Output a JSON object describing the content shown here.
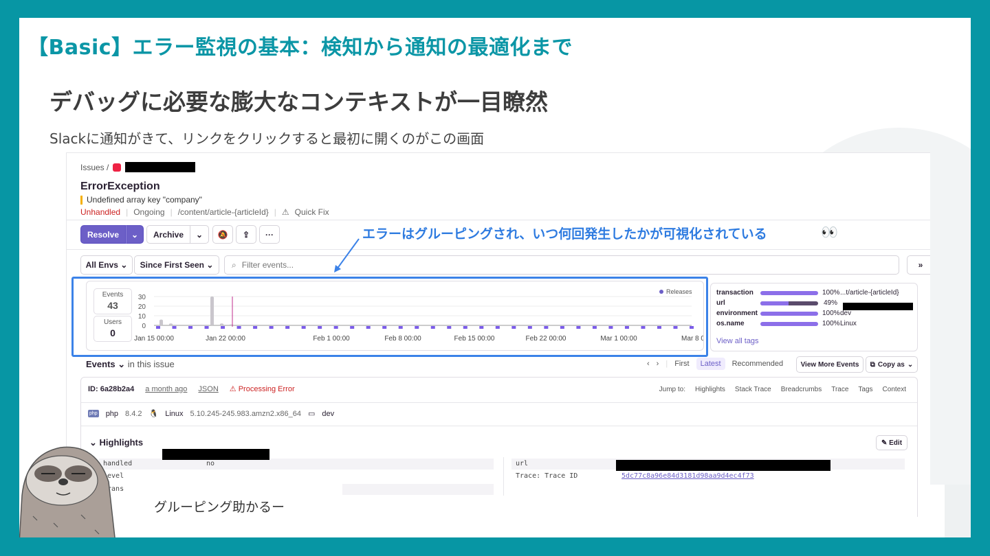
{
  "slide": {
    "title": "【Basic】エラー監視の基本：検知から通知の最適化まで",
    "heading": "デバッグに必要な膨大なコンテキストが一目瞭然",
    "subtitle": "Slackに通知がきて、リンクをクリックすると最初に開くのがこの画面",
    "annotation": "エラーはグルーピングされ、いつ何回発生したかが可視化されている",
    "eyes": "👀",
    "caption": "グルーピング助かるー",
    "colors": {
      "slide_bg": "#0796a4",
      "title": "#0b96a6",
      "annotation": "#2e7be0",
      "accent": "#6c5fc7"
    }
  },
  "issue": {
    "breadcrumb": "Issues /",
    "title": "ErrorException",
    "message": "Undefined array key \"company\"",
    "status": "Unhandled",
    "state": "Ongoing",
    "culprit": "/content/article-{articleId}",
    "quick_fix": "Quick Fix"
  },
  "toolbar": {
    "resolve": "Resolve",
    "archive": "Archive",
    "more": "···"
  },
  "filters": {
    "env": "All Envs",
    "period": "Since First Seen",
    "search_placeholder": "Filter events...",
    "expand": "»"
  },
  "stats": {
    "events_label": "Events",
    "events_value": "43",
    "users_label": "Users",
    "users_value": "0"
  },
  "chart_data": {
    "type": "bar",
    "y_ticks": [
      "30",
      "20",
      "10",
      "0"
    ],
    "ylim": [
      0,
      30
    ],
    "x_tick_labels": [
      "Jan 15 00:00",
      "Jan 22 00:00",
      "Feb 1 00:00",
      "Feb 8 00:00",
      "Feb 15 00:00",
      "Feb 22 00:00",
      "Mar 1 00:00",
      "Mar 8 0"
    ],
    "legend": "Releases",
    "series": [
      {
        "values": [
          6,
          2,
          0,
          0,
          30,
          2,
          1,
          0,
          0
        ]
      }
    ],
    "release_markers": 34
  },
  "tags": {
    "rows": [
      {
        "key": "transaction",
        "pct": "100%",
        "value": "...t/article-{articleId}",
        "fill": 1.0
      },
      {
        "key": "url",
        "pct": "49%",
        "value": "",
        "fill": 0.49
      },
      {
        "key": "environment",
        "pct": "100%",
        "value": "dev",
        "fill": 1.0
      },
      {
        "key": "os.name",
        "pct": "100%",
        "value": "Linux",
        "fill": 1.0
      }
    ],
    "view_all": "View all tags"
  },
  "events": {
    "label": "Events",
    "scope": "in this issue",
    "first": "First",
    "latest": "Latest",
    "recommended": "Recommended",
    "view_more": "View More Events",
    "copy_as": "Copy as"
  },
  "event": {
    "id": "ID: 6a28b2a4",
    "time": "a month ago",
    "json": "JSON",
    "processing_error": "Processing Error",
    "jump_label": "Jump to:",
    "jump": [
      "Highlights",
      "Stack Trace",
      "Breadcrumbs",
      "Trace",
      "Tags",
      "Context"
    ],
    "php_badge": "php",
    "php": "php",
    "php_version": "8.4.2",
    "os": "Linux",
    "os_version": "5.10.245-245.983.amzn2.x86_64",
    "env": "dev",
    "highlights": "Highlights",
    "edit": "Edit",
    "handled_key": "handled",
    "handled_val": "no",
    "level_key": "level",
    "trans_key": "trans",
    "url_key": "url",
    "trace_key": "Trace: Trace ID",
    "trace_val": "5dc77c8a96e84d3181d98aa9d4ec4f73"
  }
}
